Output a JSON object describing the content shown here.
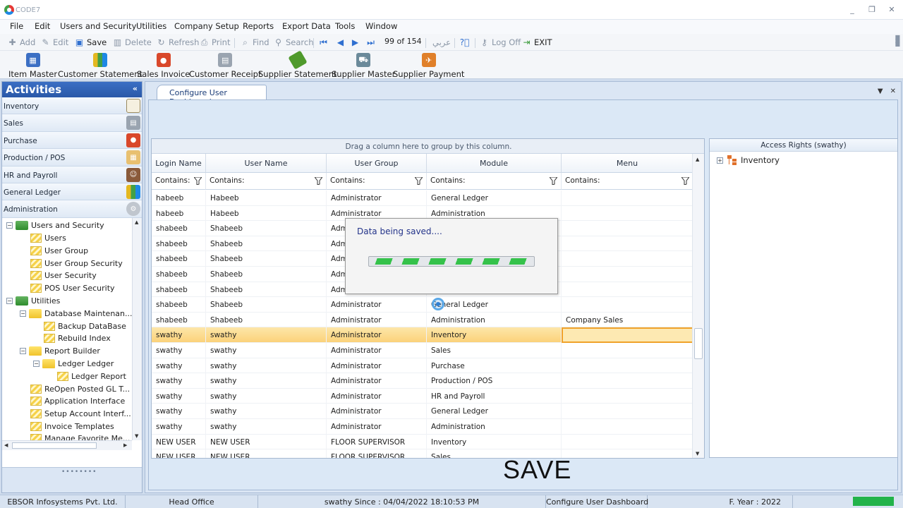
{
  "app": {
    "title": "CODE7",
    "win_min": "_",
    "win_restore": "❐",
    "win_close": "✕"
  },
  "menu": [
    "File",
    "Edit",
    "Users and Security",
    "Utilities",
    "Company Setup",
    "Reports",
    "Export Data",
    "Tools",
    "Window"
  ],
  "toolbar": {
    "add": "Add",
    "edit": "Edit",
    "save": "Save",
    "delete": "Delete",
    "refresh": "Refresh",
    "print": "Print",
    "find": "Find",
    "search": "Search",
    "record_counter": "99 of 154",
    "arabic": "عربي",
    "logoff": "Log Off",
    "exit": "EXIT"
  },
  "shortcuts": [
    "Item Master",
    "Customer Statement",
    "Sales Invoice",
    "Customer Receipt",
    "Supplier Statement",
    "Supplier Master",
    "Supplier Payment"
  ],
  "sidebar": {
    "title": "Activities",
    "collapse": "«",
    "categories": [
      "Inventory",
      "Sales",
      "Purchase",
      "Production / POS",
      "HR and Payroll",
      "General Ledger",
      "Administration"
    ],
    "tree": [
      "Users and Security",
      "Users",
      "User Group",
      "User Group Security",
      "User Security",
      "POS User Security",
      "Utilities",
      "Database  Maintenan...",
      "Backup DataBase",
      "Rebuild Index",
      "Report Builder",
      "Ledger Ledger",
      "Ledger Report",
      "ReOpen Posted GL T...",
      "Application Interface",
      "Setup Account Interf...",
      "Invoice Templates",
      "Manage Favorite Me..."
    ],
    "grip": "••••••••"
  },
  "tab": {
    "label": "Configure User Dashboard"
  },
  "grid": {
    "group_hint": "Drag a column here to group by this column.",
    "columns": [
      "Login Name",
      "User Name",
      "User Group",
      "Module",
      "Menu"
    ],
    "filter_label": "Contains:",
    "rows": [
      [
        "habeeb",
        "Habeeb",
        "Administrator",
        "General Ledger",
        ""
      ],
      [
        "habeeb",
        "Habeeb",
        "Administrator",
        "Administration",
        ""
      ],
      [
        "shabeeb",
        "Shabeeb",
        "Adm",
        "",
        ""
      ],
      [
        "shabeeb",
        "Shabeeb",
        "Adm",
        "",
        ""
      ],
      [
        "shabeeb",
        "Shabeeb",
        "Adm",
        "",
        ""
      ],
      [
        "shabeeb",
        "Shabeeb",
        "Adm",
        "",
        ""
      ],
      [
        "shabeeb",
        "Shabeeb",
        "Adm",
        "",
        ""
      ],
      [
        "shabeeb",
        "Shabeeb",
        "Administrator",
        "General Ledger",
        ""
      ],
      [
        "shabeeb",
        "Shabeeb",
        "Administrator",
        "Administration",
        "Company Sales"
      ],
      [
        "swathy",
        "swathy",
        "Administrator",
        "Inventory",
        ""
      ],
      [
        "swathy",
        "swathy",
        "Administrator",
        "Sales",
        ""
      ],
      [
        "swathy",
        "swathy",
        "Administrator",
        "Purchase",
        ""
      ],
      [
        "swathy",
        "swathy",
        "Administrator",
        "Production / POS",
        ""
      ],
      [
        "swathy",
        "swathy",
        "Administrator",
        "HR and Payroll",
        ""
      ],
      [
        "swathy",
        "swathy",
        "Administrator",
        "General Ledger",
        ""
      ],
      [
        "swathy",
        "swathy",
        "Administrator",
        "Administration",
        ""
      ],
      [
        "NEW USER",
        "NEW USER",
        "FLOOR SUPERVISOR",
        "Inventory",
        ""
      ],
      [
        "NEW USER",
        "NEW USER",
        "FLOOR SUPERVISOR",
        "Sales",
        ""
      ]
    ],
    "selected_row_index": 9
  },
  "access": {
    "title": "Access Rights  (swathy)",
    "node": "Inventory"
  },
  "dialog": {
    "message": "Data being saved...."
  },
  "caption": "SAVE",
  "status": {
    "company": "EBSOR Infosystems Pvt. Ltd.",
    "branch": "Head Office",
    "user": "swathy Since : 04/04/2022 18:10:53 PM",
    "screen": "Configure User Dashboard",
    "year": "F. Year : 2022"
  },
  "colors": {
    "accent": "#2a58a8",
    "selection": "#fbd27a",
    "progress": "#35c24a"
  }
}
